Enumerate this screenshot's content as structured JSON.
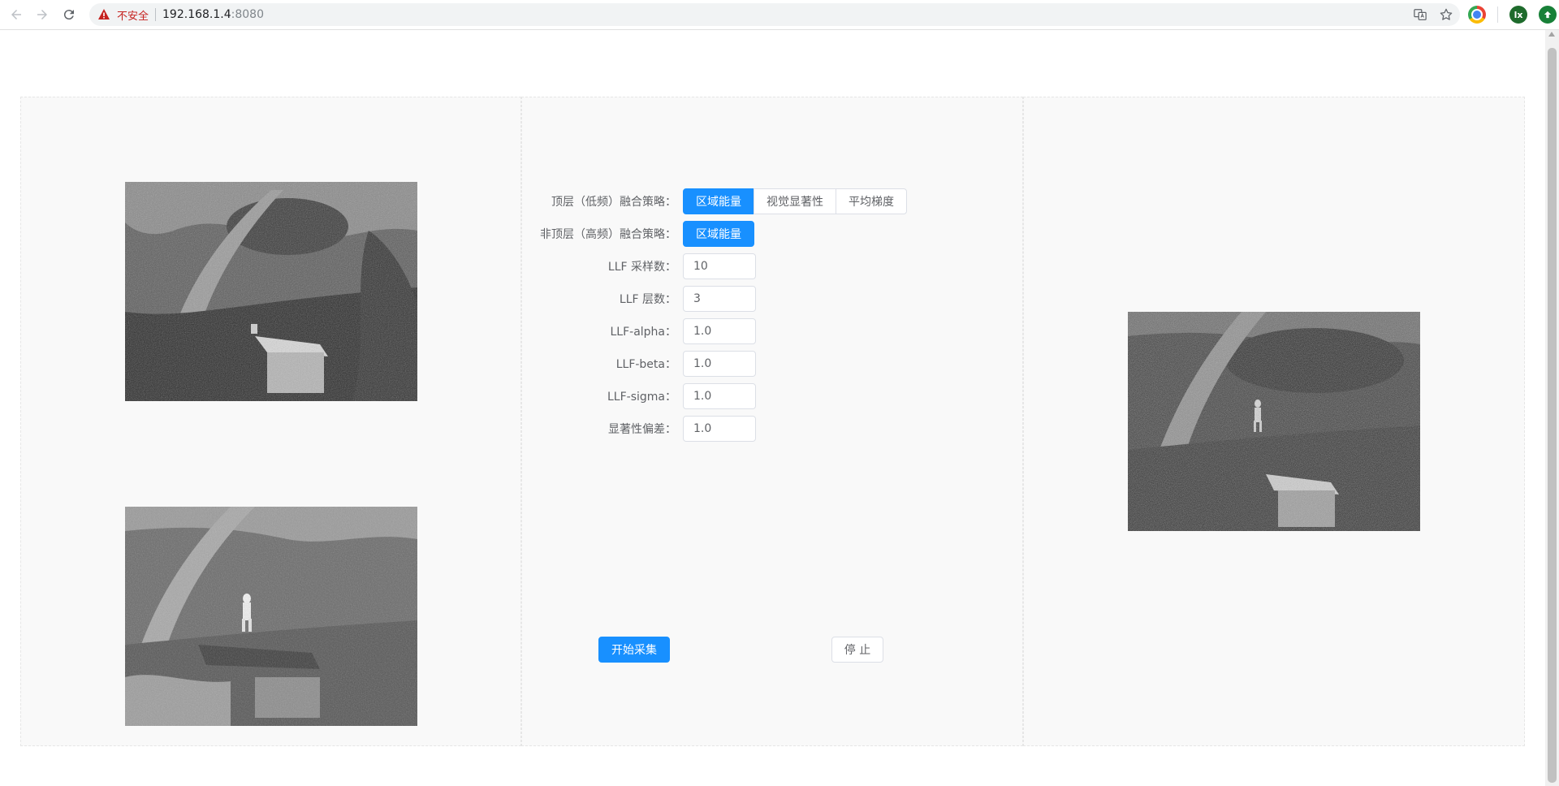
{
  "browser": {
    "insecure_label": "不安全",
    "url_host": "192.168.1.4",
    "url_port": ":8080",
    "avatar_initials": "lx"
  },
  "fusion": {
    "top_layer_label": "顶层（低频）融合策略：",
    "top_layer_options": [
      "区域能量",
      "视觉显著性",
      "平均梯度"
    ],
    "top_layer_selected": "区域能量",
    "non_top_layer_label": "非顶层（高频）融合策略：",
    "non_top_layer_options": [
      "区域能量"
    ],
    "non_top_layer_selected": "区域能量"
  },
  "params": [
    {
      "label": "LLF 采样数：",
      "value": "10"
    },
    {
      "label": "LLF 层数：",
      "value": "3"
    },
    {
      "label": "LLF-alpha：",
      "value": "1.0"
    },
    {
      "label": "LLF-beta：",
      "value": "1.0"
    },
    {
      "label": "LLF-sigma：",
      "value": "1.0"
    },
    {
      "label": "显著性偏差：",
      "value": "1.0"
    }
  ],
  "actions": {
    "start_label": "开始采集",
    "stop_label": "停 止"
  },
  "colors": {
    "primary": "#1890ff",
    "insecure": "#c5221f"
  }
}
